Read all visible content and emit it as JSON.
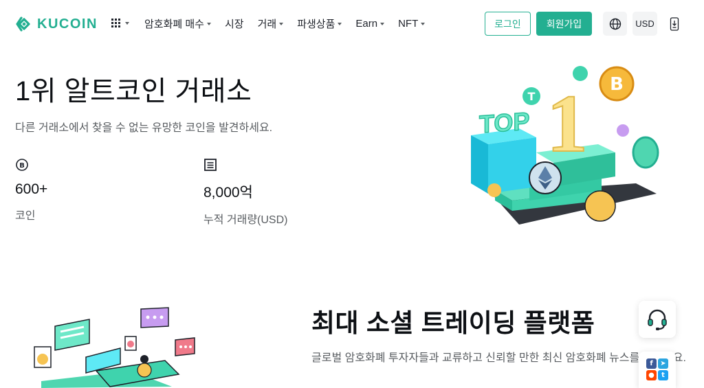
{
  "brand": {
    "name": "KUCOIN",
    "color": "#23af91"
  },
  "nav": {
    "apps_icon": "grid-icon",
    "menu": [
      {
        "label": "암호화폐 매수",
        "has_caret": true
      },
      {
        "label": "시장",
        "has_caret": false
      },
      {
        "label": "거래",
        "has_caret": true
      },
      {
        "label": "파생상품",
        "has_caret": true
      },
      {
        "label": "Earn",
        "has_caret": true
      },
      {
        "label": "NFT",
        "has_caret": true
      }
    ],
    "login_label": "로그인",
    "signup_label": "회원가입",
    "language_icon": "globe-icon",
    "currency": "USD",
    "download_icon": "download-phone-icon"
  },
  "hero": {
    "title": "1위 알트코인 거래소",
    "subtitle": "다른 거래소에서 찾을 수 없는 유망한 코인을 발견하세요.",
    "stats": [
      {
        "icon": "bitcoin-circle-icon",
        "value": "600+",
        "label": "코인"
      },
      {
        "icon": "ledger-icon",
        "value": "8,000억",
        "label": "누적 거래량(USD)"
      }
    ],
    "illustration": {
      "sign_text": "TOP",
      "rank_text": "1"
    }
  },
  "social_section": {
    "title": "최대 소셜 트레이딩 플랫폼",
    "text": "글로벌 암호화폐 투자자들과 교류하고 신뢰할 만한 최신 암호화폐 뉴스를 접하세요."
  },
  "floating": {
    "support_icon": "headset-icon",
    "social_icons": [
      "facebook-icon",
      "telegram-icon",
      "reddit-icon",
      "twitter-icon"
    ]
  },
  "colors": {
    "accent": "#23af91",
    "text_primary": "#0d1014",
    "text_secondary": "#595d61",
    "button_bg": "#f3f4f5"
  }
}
